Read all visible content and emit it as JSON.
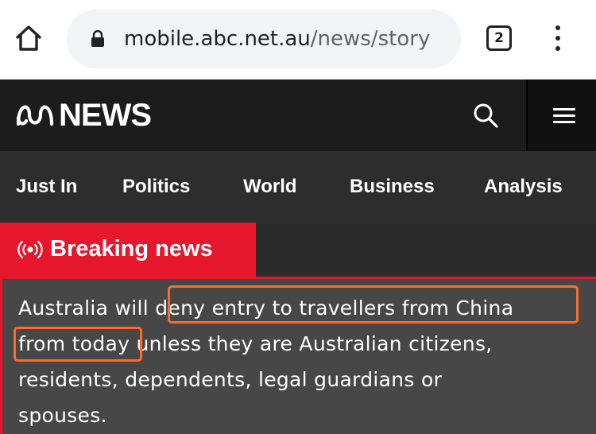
{
  "browser": {
    "url_host": "mobile.abc.net.au",
    "url_path": "/news/story",
    "tab_count": "2"
  },
  "header": {
    "brand": "NEWS"
  },
  "nav": {
    "items": [
      "Just In",
      "Politics",
      "World",
      "Business",
      "Analysis"
    ]
  },
  "article": {
    "badge": "Breaking news",
    "lines": [
      "Australia will deny entry to travellers from China",
      "from today unless they are Australian citizens,",
      "residents, dependents, legal guardians or",
      "spouses."
    ]
  },
  "colors": {
    "breaking_red": "#e6162d",
    "highlight_orange": "#ff6a28",
    "header_bg": "#1c1c1c",
    "nav_bg": "#2d2d2d",
    "body_bg": "#474747"
  },
  "icons": [
    "home-icon",
    "lock-icon",
    "tabs-icon",
    "overflow-menu-icon",
    "abc-logo",
    "search-icon",
    "hamburger-menu-icon",
    "live-broadcast-icon"
  ]
}
